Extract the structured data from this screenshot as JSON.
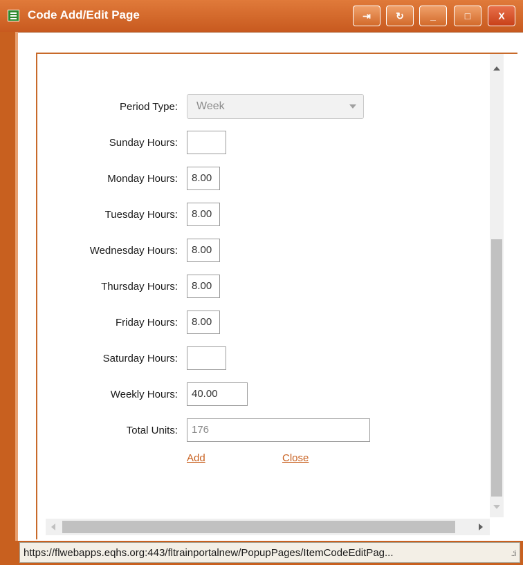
{
  "window": {
    "title": "Code Add/Edit Page",
    "controls": {
      "pin": "⇥",
      "refresh": "↻",
      "minimize": "_",
      "maximize": "□",
      "close": "X"
    }
  },
  "form": {
    "period_type": {
      "label": "Period Type:",
      "value": "Week"
    },
    "fields": [
      {
        "label": "Sunday Hours:",
        "value": ""
      },
      {
        "label": "Monday Hours:",
        "value": "8.00"
      },
      {
        "label": "Tuesday Hours:",
        "value": "8.00"
      },
      {
        "label": "Wednesday Hours:",
        "value": "8.00"
      },
      {
        "label": "Thursday Hours:",
        "value": "8.00"
      },
      {
        "label": "Friday Hours:",
        "value": "8.00"
      },
      {
        "label": "Saturday Hours:",
        "value": ""
      }
    ],
    "weekly_hours": {
      "label": "Weekly Hours:",
      "value": "40.00"
    },
    "total_units": {
      "label": "Total Units:",
      "value": "176"
    },
    "actions": {
      "add": "Add",
      "close": "Close"
    }
  },
  "status_bar": {
    "url": "https://flwebapps.eqhs.org:443/fltrainportalnew/PopupPages/ItemCodeEditPag...",
    "grip": ".:i"
  },
  "colors": {
    "title_bar": "#c85a1f",
    "accent": "#c8601f",
    "link": "#c8601f"
  }
}
